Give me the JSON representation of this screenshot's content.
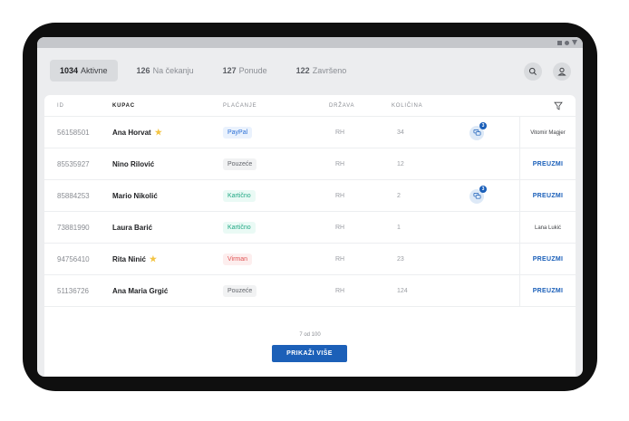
{
  "tabs": [
    {
      "count": "1034",
      "label": "Aktivne"
    },
    {
      "count": "126",
      "label": "Na čekanju"
    },
    {
      "count": "127",
      "label": "Ponude"
    },
    {
      "count": "122",
      "label": "Završeno"
    }
  ],
  "header_icons": {
    "search": "search-icon",
    "user": "user-icon"
  },
  "table": {
    "columns": [
      "ID",
      "KUPAC",
      "PLAĆANJE",
      "DRŽAVA",
      "KOLIČINA"
    ],
    "filter_icon": "filter-icon",
    "rows": [
      {
        "id": "56158501",
        "name": "Ana Horvat",
        "star": "★",
        "payment": "PayPal",
        "country": "RH",
        "qty": "34",
        "messages": "3",
        "action": "Vitomir Magjer"
      },
      {
        "id": "85535927",
        "name": "Nino Rilović",
        "star": "",
        "payment": "Pouzeće",
        "country": "RH",
        "qty": "12",
        "messages": "",
        "action": "PREUZMI"
      },
      {
        "id": "85884253",
        "name": "Mario Nikolić",
        "star": "",
        "payment": "Kartično",
        "country": "RH",
        "qty": "2",
        "messages": "3",
        "action": "PREUZMI"
      },
      {
        "id": "73881990",
        "name": "Laura Barić",
        "star": "",
        "payment": "Kartično",
        "country": "RH",
        "qty": "1",
        "messages": "",
        "action": "Lana Lukić"
      },
      {
        "id": "94756410",
        "name": "Rita Ninić",
        "star": "★",
        "payment": "Virman",
        "country": "RH",
        "qty": "23",
        "messages": "",
        "action": "PREUZMI"
      },
      {
        "id": "51136726",
        "name": "Ana Maria Grgić",
        "star": "",
        "payment": "Pouzeće",
        "country": "RH",
        "qty": "124",
        "messages": "",
        "action": "PREUZMI"
      }
    ]
  },
  "pagination": {
    "text": "7 od 100",
    "more_label": "PRIKAŽI VIŠE"
  },
  "colors": {
    "accent": "#1c60b8",
    "paypal": "#2b6fd6",
    "karticno": "#22a884",
    "virman": "#e05353"
  }
}
